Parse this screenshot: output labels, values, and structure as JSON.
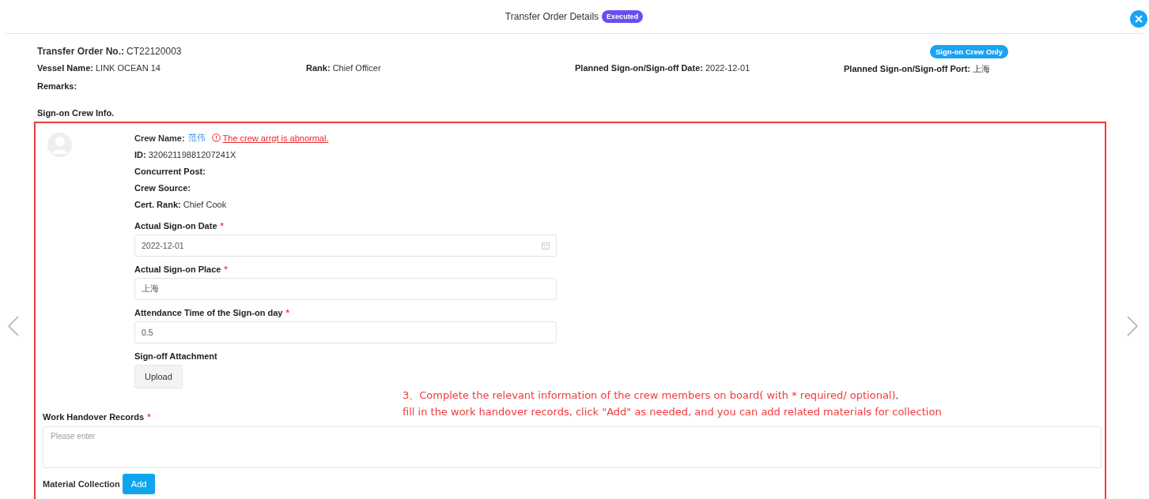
{
  "dialog": {
    "title": "Transfer Order Details",
    "status": "Executed"
  },
  "order": {
    "number_label": "Transfer Order No.:",
    "number": "CT22120003",
    "badge": "Sign-on Crew Only",
    "info": [
      {
        "label": "Vessel Name:",
        "value": "LINK OCEAN 14"
      },
      {
        "label": "Rank:",
        "value": "Chief Officer"
      },
      {
        "label": "Planned Sign-on/Sign-off Date:",
        "value": "2022-12-01"
      },
      {
        "label": "Planned Sign-on/Sign-off Port:",
        "value": "上海"
      }
    ],
    "remarks_label": "Remarks:"
  },
  "section_title": "Sign-on Crew Info.",
  "crew": {
    "name_label": "Crew Name:",
    "name": "范伟",
    "warning": "The crew arrgt is abnormal.",
    "details": [
      {
        "label": "ID:",
        "value": "32062119881207241X"
      },
      {
        "label": "Concurrent Post:"
      },
      {
        "label": "Crew Source:"
      },
      {
        "label": "Cert. Rank:",
        "value": "Chief Cook"
      }
    ],
    "fields": [
      {
        "kind": "date",
        "label": "Actual Sign-on Date",
        "required_mark": "*",
        "value": "2022-12-01"
      },
      {
        "kind": "text",
        "label": "Actual Sign-on Place",
        "required_mark": "*",
        "value": "上海"
      },
      {
        "kind": "text",
        "label": "Attendance Time of the Sign-on day",
        "required_mark": "*",
        "value": "0.5"
      },
      {
        "kind": "upload",
        "label": "Sign-off Attachment",
        "button": "Upload"
      }
    ]
  },
  "handover": {
    "label": "Work Handover Records",
    "required_mark": "*",
    "placeholder": "Please enter"
  },
  "material": {
    "label": "Material Collection",
    "button": "Add"
  },
  "annotation": [
    "3、Complete the relevant information of the crew members on board( with * required/ optional),",
    "fill in the work handover records, click \"Add\" as needed, and you can add related materials for collection"
  ]
}
